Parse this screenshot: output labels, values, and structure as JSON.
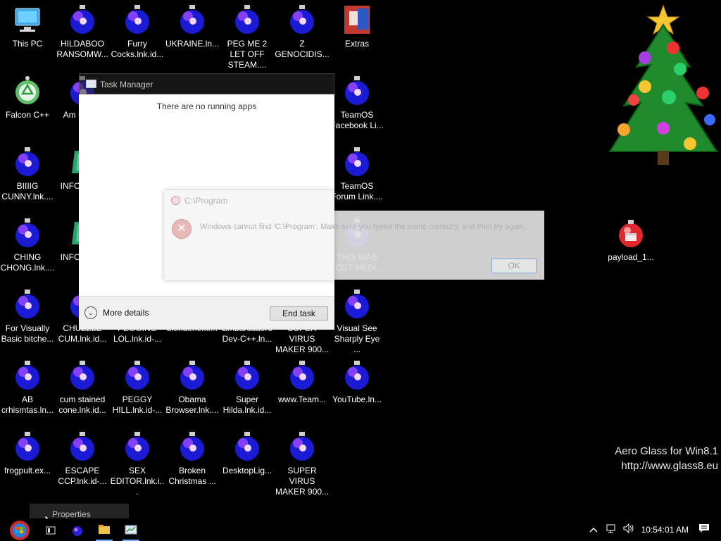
{
  "desktop": {
    "icons": [
      {
        "label": "This PC",
        "kind": "computer-icon"
      },
      {
        "label": "HILDABOO RANSOMW...",
        "kind": "ornament-icon"
      },
      {
        "label": "Furry Cocks.lnk.id...",
        "kind": "ornament-icon"
      },
      {
        "label": "UKRAINE.ln...",
        "kind": "ornament-icon"
      },
      {
        "label": "PEG ME 2 LET OFF STEAM....",
        "kind": "ornament-icon"
      },
      {
        "label": "Z GENOCIDIS...",
        "kind": "ornament-icon"
      },
      {
        "label": "Extras",
        "kind": "extras-icon"
      },
      {
        "label": "Falcon C++",
        "kind": "recycle-icon"
      },
      {
        "label": "Am Us.lnk",
        "kind": "ornament-icon"
      },
      {
        "label": "TeamOS Facebook Li...",
        "kind": "ornament-icon"
      },
      {
        "label": "BIIIIG CUNNY.lnk....",
        "kind": "ornament-icon"
      },
      {
        "label": "INFOR how",
        "kind": "book-icon"
      },
      {
        "label": "TeamOS Forum Link....",
        "kind": "ornament-icon"
      },
      {
        "label": "CHING CHONG.lnk....",
        "kind": "ornament-icon"
      },
      {
        "label": "INFOR how",
        "kind": "book-icon"
      },
      {
        "label": "THIS WAS LOST MEDI...",
        "kind": "ornament-icon"
      },
      {
        "label": "payload_1...",
        "kind": "payload-icon"
      },
      {
        "label": "For Visually Basic bitche...",
        "kind": "ornament-icon"
      },
      {
        "label": "CHUZZLE CUM.lnk.id...",
        "kind": "ornament-icon"
      },
      {
        "label": "PEGGING LOL.lnk.id-...",
        "kind": "ornament-icon"
      },
      {
        "label": "blender.exe...",
        "kind": "ornament-icon"
      },
      {
        "label": "Embarcadero Dev-C++.ln...",
        "kind": "ornament-icon"
      },
      {
        "label": "SUPER VIRUS MAKER 900...",
        "kind": "ornament-icon"
      },
      {
        "label": "Visual See Sharply Eye ...",
        "kind": "ornament-icon"
      },
      {
        "label": "AB crhismtas.ln...",
        "kind": "ornament-icon"
      },
      {
        "label": "cum stained cone.lnk.id...",
        "kind": "ornament-icon"
      },
      {
        "label": "PEGGY HILL.lnk.id-...",
        "kind": "ornament-icon"
      },
      {
        "label": "Obama Browser.lnk....",
        "kind": "ornament-icon"
      },
      {
        "label": "Super Hilda.lnk.id...",
        "kind": "ornament-icon"
      },
      {
        "label": "www.Team...",
        "kind": "ornament-icon"
      },
      {
        "label": "YouTube.ln...",
        "kind": "ornament-icon"
      },
      {
        "label": "frogpult.ex...",
        "kind": "ornament-icon"
      },
      {
        "label": "ESCAPE CCP.lnk.id-...",
        "kind": "ornament-icon"
      },
      {
        "label": "SEX EDITOR.lnk.i...",
        "kind": "ornament-icon"
      },
      {
        "label": "Broken Christmas ...",
        "kind": "ornament-icon"
      },
      {
        "label": "DesktopLig...",
        "kind": "ornament-icon"
      },
      {
        "label": "SUPER VIRUS MAKER 900...",
        "kind": "ornament-icon"
      }
    ]
  },
  "watermark": {
    "line1": "Aero Glass for Win8.1",
    "line2": "http://www.glass8.eu"
  },
  "task_manager": {
    "title": "Task Manager",
    "empty_text": "There are no running apps",
    "more_details": "More details",
    "end_task": "End task"
  },
  "error_dialog": {
    "title": "C:\\Program",
    "message": "Windows cannot find 'C:\\Program'. Make sure you typed the name correctly, and then try again.",
    "ok": "OK"
  },
  "tooltip": {
    "text": "Properties"
  },
  "taskbar": {
    "clock": "10:54:01 AM",
    "items": [
      "task-view-icon",
      "ornament-app-icon",
      "file-explorer-icon",
      "task-manager-icon"
    ],
    "tray": [
      "chevron-up-icon",
      "network-icon",
      "volume-icon",
      "action-center-icon"
    ]
  },
  "colors": {
    "ornament_blue": "#1b1bd6",
    "ornament_highlight": "#c44bff",
    "accent_blue": "#4a90d9"
  }
}
